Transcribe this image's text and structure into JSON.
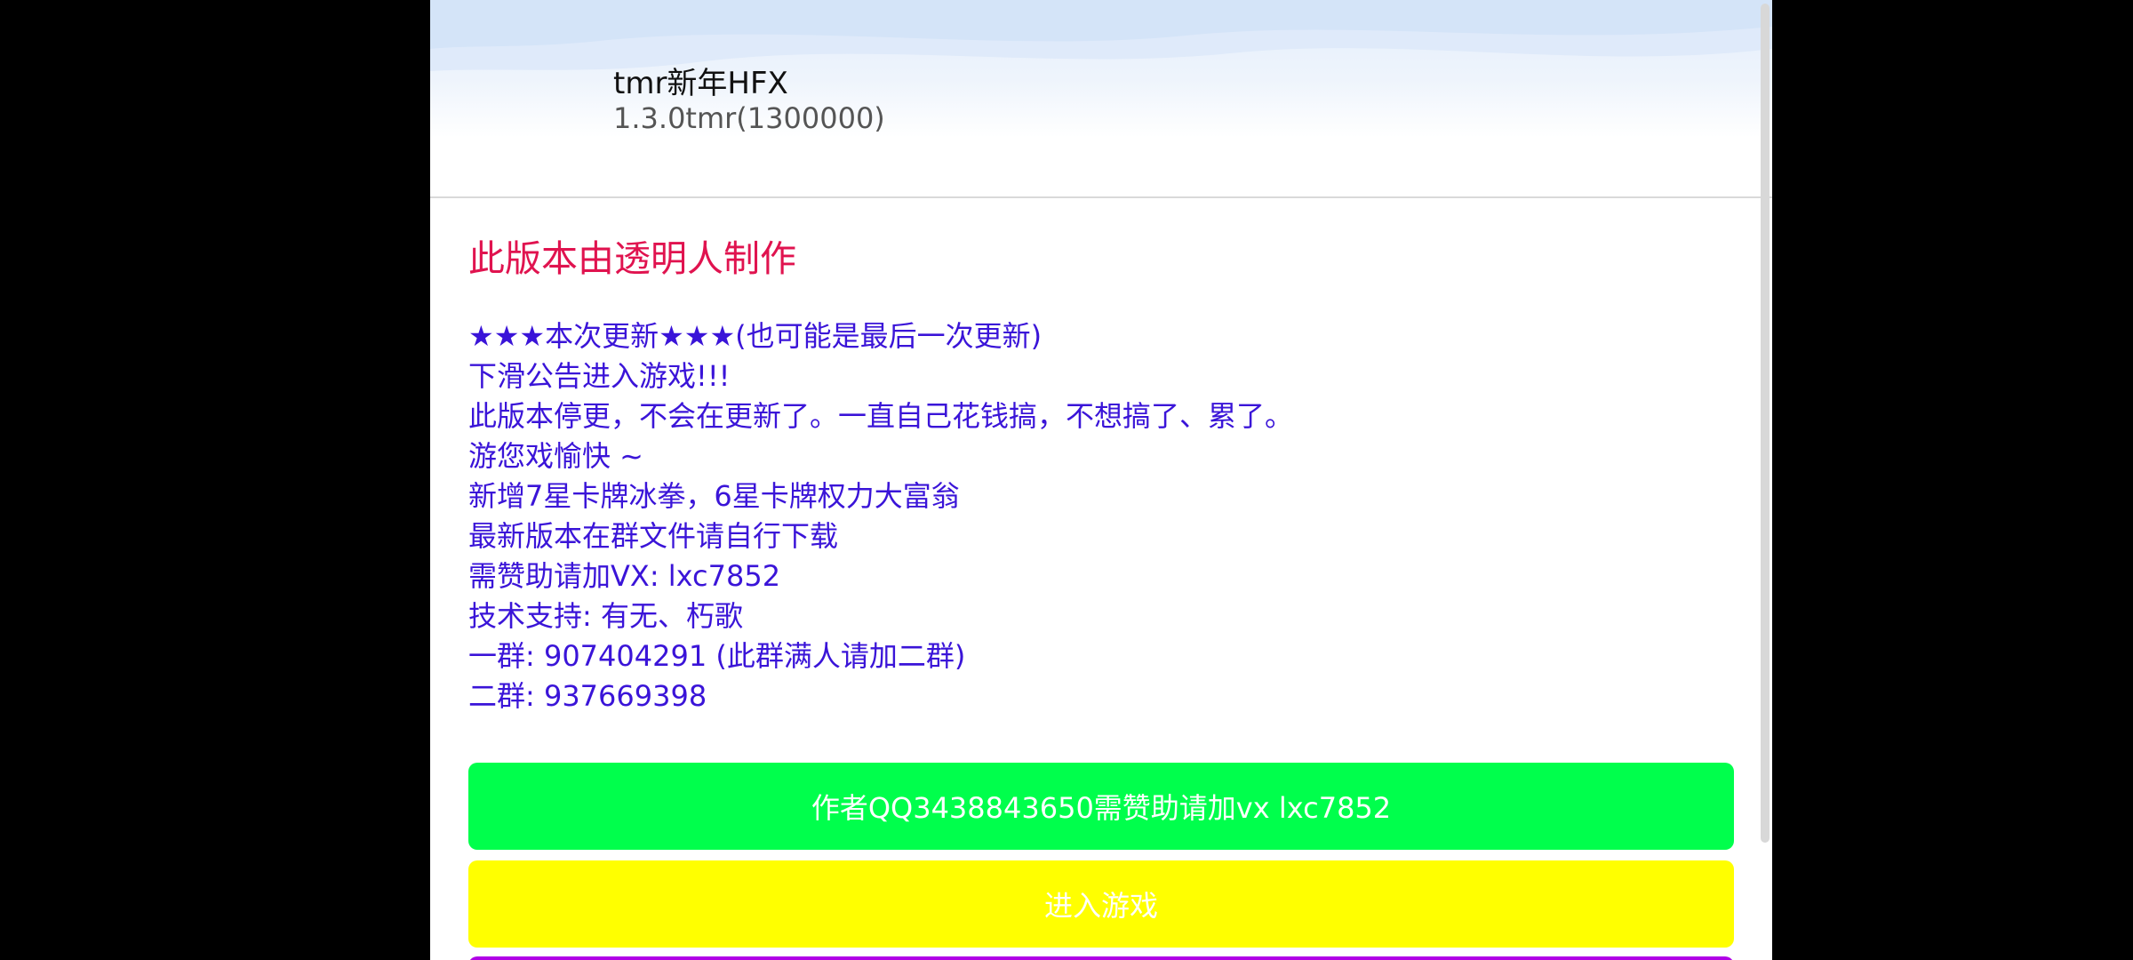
{
  "app": {
    "name": "tmr新年HFX",
    "version": "1.3.0tmr(1300000)"
  },
  "notice": {
    "title": "此版本由透明人制作",
    "lines": [
      "★★★本次更新★★★(也可能是最后一次更新)",
      "下滑公告进入游戏!!!",
      "此版本停更，不会在更新了。一直自己花钱搞，不想搞了、累了。",
      "游您戏愉快 ~",
      "新增7星卡牌冰拳，6星卡牌权力大富翁",
      "最新版本在群文件请自行下载",
      "需赞助请加VX: lxc7852",
      "技术支持: 有无、朽歌",
      "一群: 907404291 (此群满人请加二群)",
      "二群: 937669398"
    ]
  },
  "buttons": {
    "author_label": "作者QQ3438843650需赞助请加vx  lxc7852",
    "enter_label": "进入游戏"
  },
  "colors": {
    "title": "#e0134f",
    "text": "#3a14d8",
    "author_button": "#00ff4c",
    "enter_button": "#ffff00",
    "third_button": "#b000e6"
  }
}
